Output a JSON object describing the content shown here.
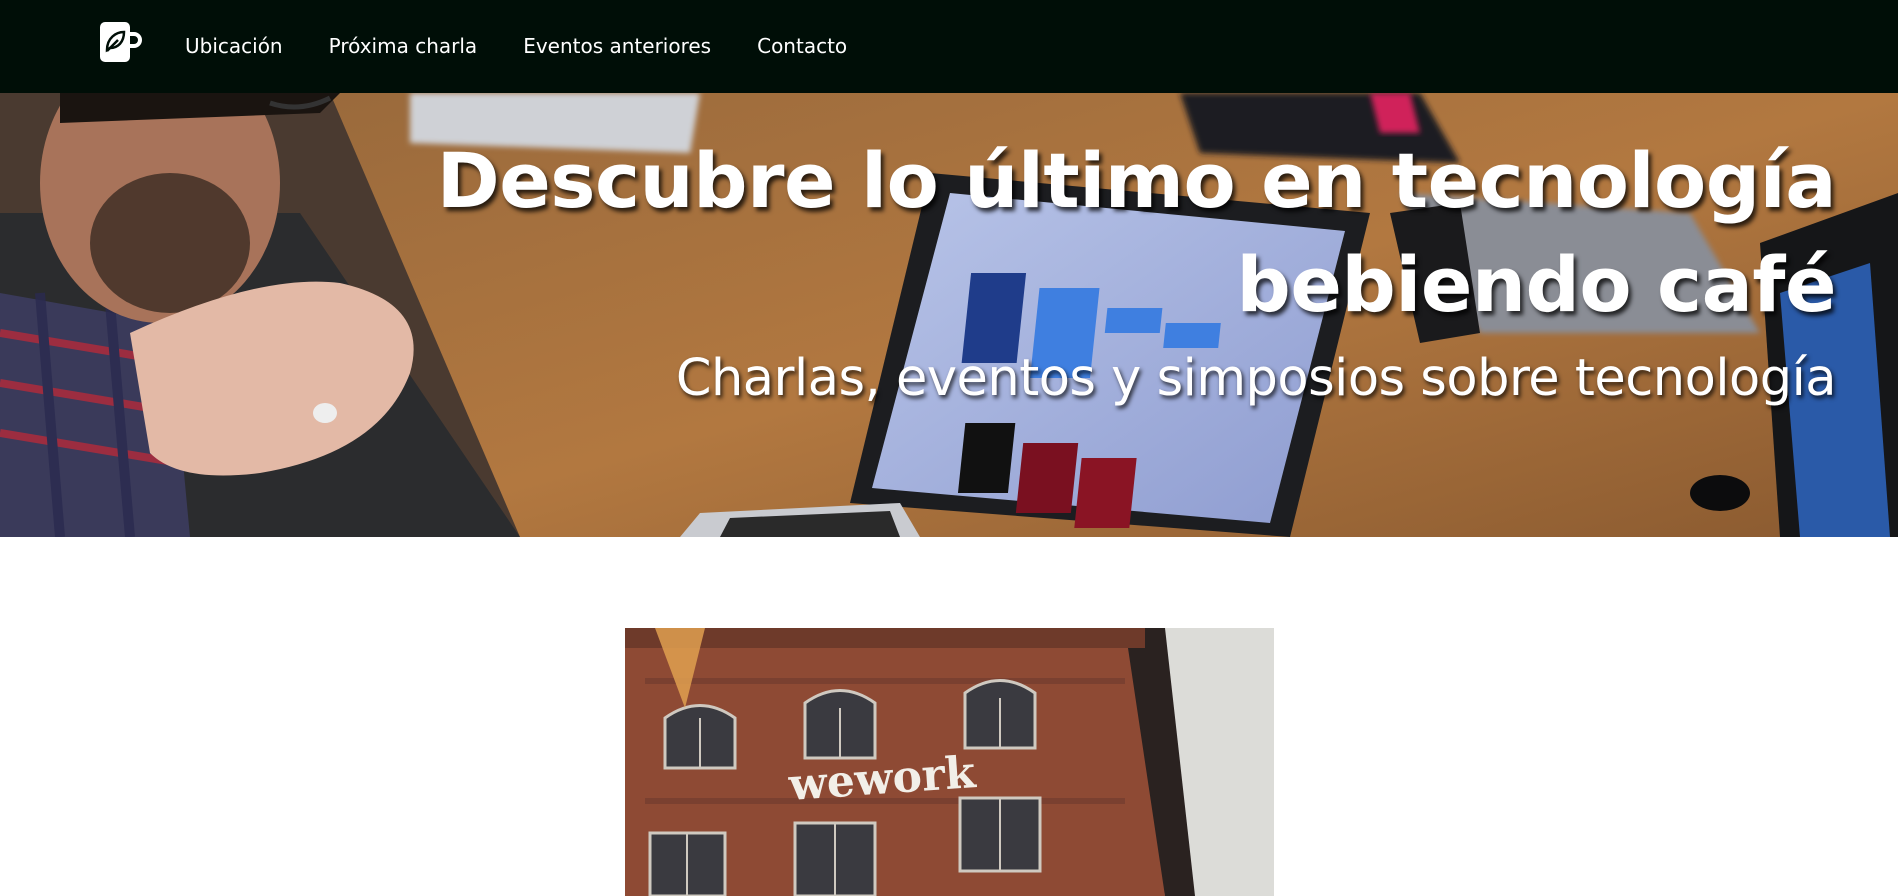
{
  "nav": {
    "logo_icon": "coffee-mug-leaf-icon",
    "links": [
      {
        "label": "Ubicación"
      },
      {
        "label": "Próxima charla"
      },
      {
        "label": "Eventos anteriores"
      },
      {
        "label": "Contacto"
      }
    ]
  },
  "hero": {
    "title": "Descubre lo último en tecnología bebiendo café",
    "subtitle": "Charlas, eventos y simposios sobre tecnología",
    "background": "photo-laptop-meeting"
  },
  "venue": {
    "photo": "photo-brick-building",
    "sign_text": "wework"
  },
  "colors": {
    "navbar_bg": "#000e07",
    "nav_text": "#ffffff",
    "hero_text": "#ffffff"
  }
}
